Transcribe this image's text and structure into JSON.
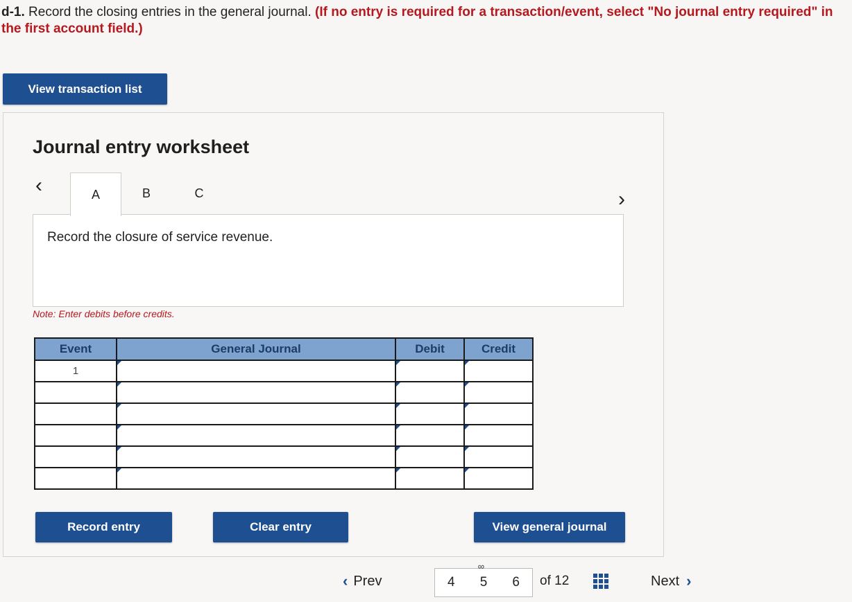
{
  "instructions": {
    "label": "d-1.",
    "text": " Record the closing entries in the general journal. ",
    "emphasis": "(If no entry is required for a transaction/event, select \"No journal entry required\" in the first account field.)"
  },
  "buttons": {
    "view_transactions": "View transaction list",
    "record_entry": "Record entry",
    "clear_entry": "Clear entry",
    "view_general_journal": "View general journal"
  },
  "worksheet": {
    "title": "Journal entry worksheet",
    "tabs": [
      {
        "label": "A",
        "active": true
      },
      {
        "label": "B",
        "active": false
      },
      {
        "label": "C",
        "active": false
      }
    ],
    "prompt": "Record the closure of service revenue.",
    "note": "Note: Enter debits before credits."
  },
  "journal_table": {
    "headers": [
      "Event",
      "General Journal",
      "Debit",
      "Credit"
    ],
    "rows": [
      {
        "event": "1",
        "account": "",
        "debit": "",
        "credit": ""
      },
      {
        "event": "",
        "account": "",
        "debit": "",
        "credit": ""
      },
      {
        "event": "",
        "account": "",
        "debit": "",
        "credit": ""
      },
      {
        "event": "",
        "account": "",
        "debit": "",
        "credit": ""
      },
      {
        "event": "",
        "account": "",
        "debit": "",
        "credit": ""
      },
      {
        "event": "",
        "account": "",
        "debit": "",
        "credit": ""
      }
    ]
  },
  "pagination": {
    "prev_label": "Prev",
    "next_label": "Next",
    "pages": [
      "4",
      "5",
      "6"
    ],
    "current_page": "5",
    "of_total": "of 12"
  },
  "colors": {
    "primary": "#1d4f91",
    "instruction_red": "#b5181e",
    "table_header": "#7ea3cf"
  }
}
